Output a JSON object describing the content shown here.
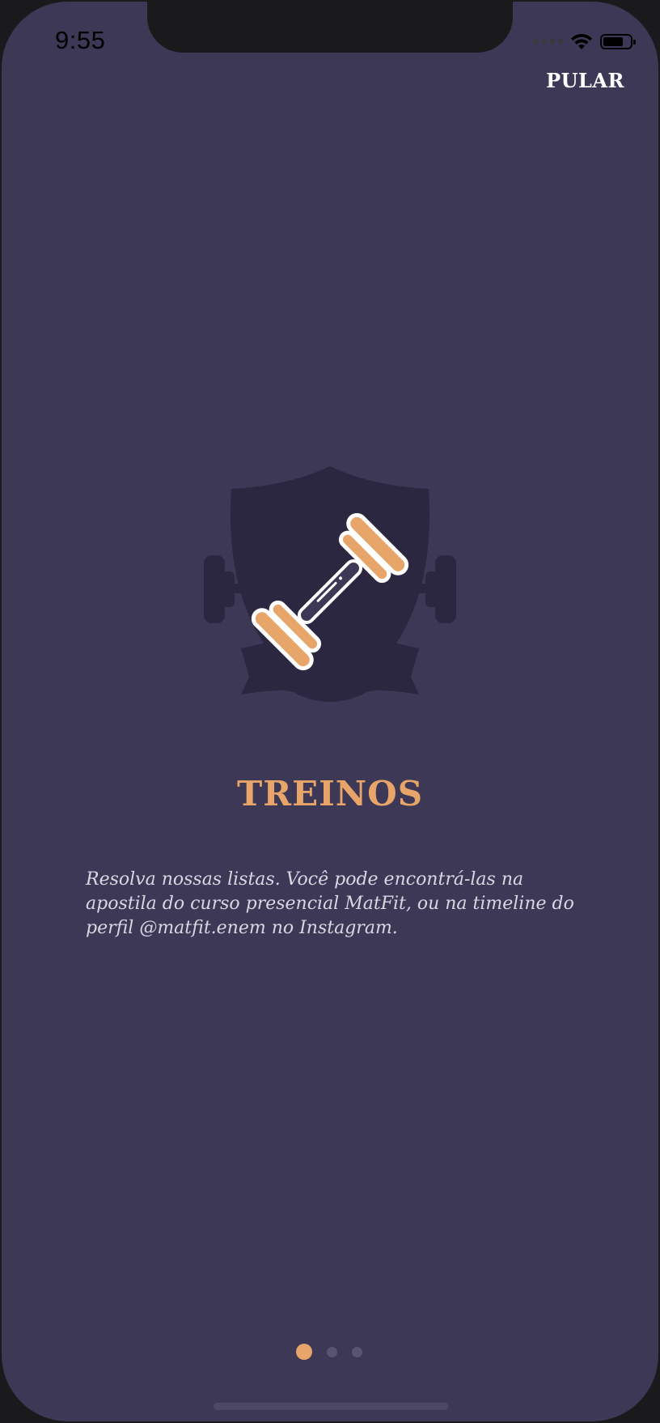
{
  "status_bar": {
    "time": "9:55"
  },
  "header": {
    "skip_label": "PULAR"
  },
  "onboarding": {
    "icon": "dumbbell-shield-icon",
    "title": "TREINOS",
    "description": "Resolva nossas listas. Você pode encontrá-las na apostila do curso presencial MatFit, ou na timeline do perfil @matfit.enem no Instagram.",
    "page_count": 3,
    "current_page": 1
  },
  "colors": {
    "background": "#3c3856",
    "accent": "#e8a56a",
    "emblem": "#2b2740",
    "text": "#d9d7e2"
  }
}
